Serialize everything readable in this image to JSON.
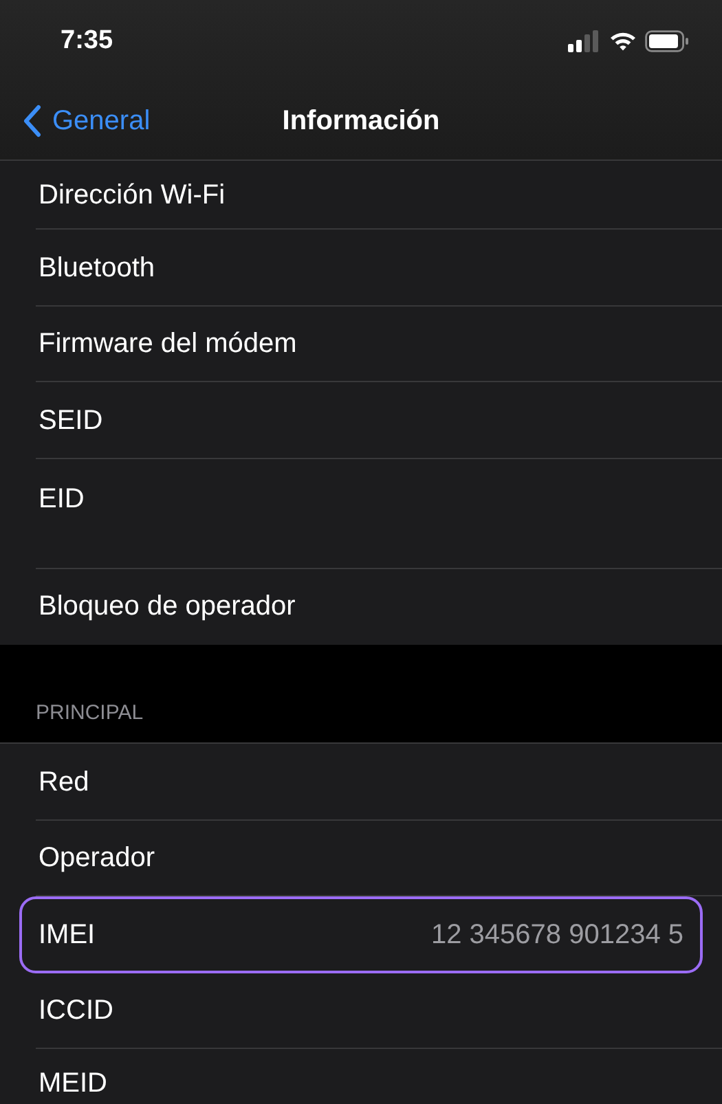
{
  "status_bar": {
    "time": "7:35"
  },
  "nav": {
    "back": "General",
    "title": "Información"
  },
  "groups": [
    {
      "rows": [
        {
          "label": "Dirección Wi-Fi",
          "kind": "clipped",
          "highlighted": false
        },
        {
          "label": "Bluetooth",
          "kind": "normal",
          "highlighted": false
        },
        {
          "label": "Firmware del módem",
          "kind": "normal",
          "highlighted": false
        },
        {
          "label": "SEID",
          "kind": "normal",
          "highlighted": false
        },
        {
          "label": "EID",
          "kind": "tall",
          "highlighted": false
        },
        {
          "label": "Bloqueo de operador",
          "kind": "normal",
          "highlighted": false
        }
      ]
    },
    {
      "header": "PRINCIPAL",
      "rows": [
        {
          "label": "Red",
          "kind": "normal",
          "highlighted": false
        },
        {
          "label": "Operador",
          "kind": "normal",
          "highlighted": false
        },
        {
          "label": "IMEI",
          "value": "12 345678 901234 5",
          "kind": "normal",
          "highlighted": true
        },
        {
          "label": "ICCID",
          "kind": "normal",
          "highlighted": false
        },
        {
          "label": "MEID",
          "kind": "clipped",
          "highlighted": false
        }
      ]
    }
  ]
}
